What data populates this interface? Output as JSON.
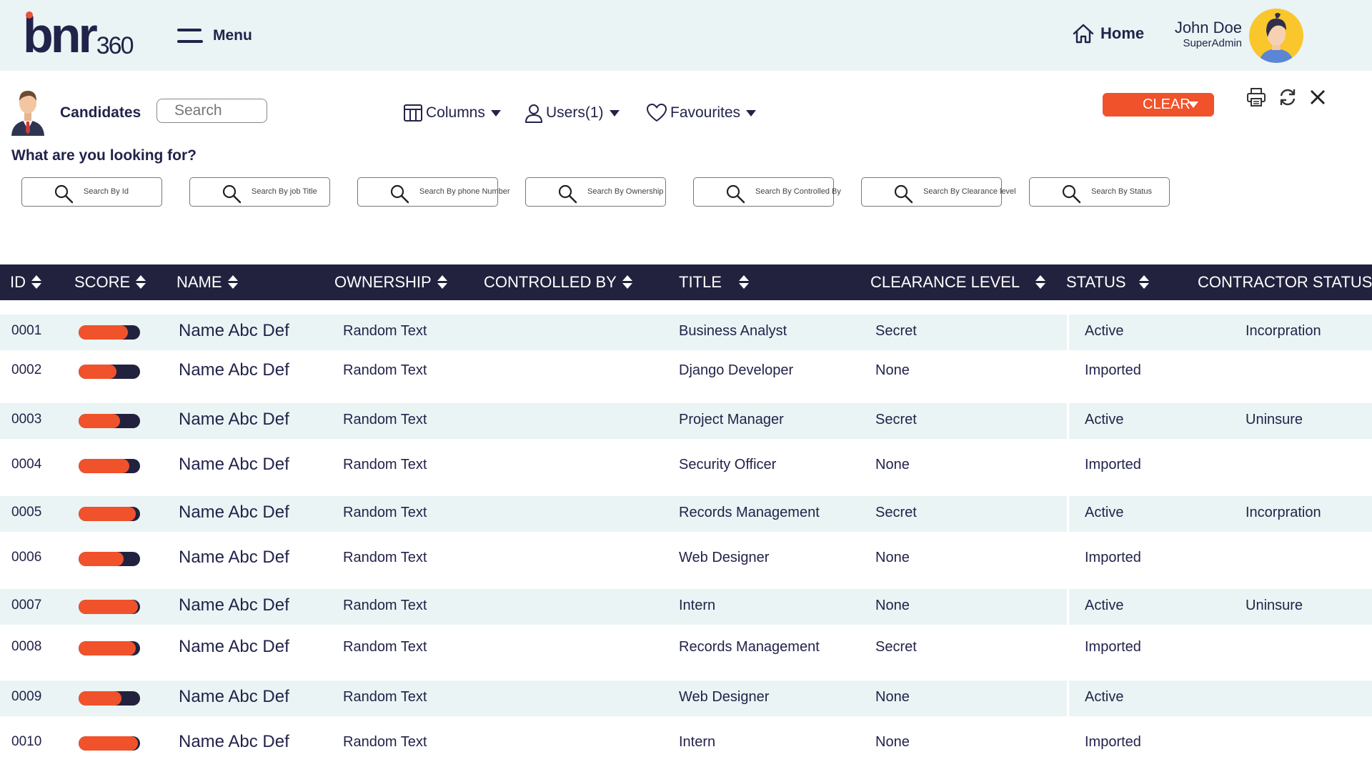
{
  "app": {
    "logo_text": "bnr",
    "logo_number": "360",
    "menu_label": "Menu",
    "home_label": "Home",
    "user": {
      "name": "John Doe",
      "role": "SuperAdmin"
    }
  },
  "toolbar": {
    "title": "Candidates",
    "search_placeholder": "Search",
    "columns_label": "Columns",
    "users_label": "Users(1)",
    "favourites_label": "Favourites",
    "clear_label": "CLEAR",
    "accent_color": "#f0522b"
  },
  "filters": {
    "heading": "What are you looking for?",
    "items": [
      {
        "placeholder": "Search By Id"
      },
      {
        "placeholder": "Search By job Title"
      },
      {
        "placeholder": "Search By  phone Number"
      },
      {
        "placeholder": "Search By Ownership"
      },
      {
        "placeholder": "Search By Controlled By"
      },
      {
        "placeholder": "Search By Clearance level"
      },
      {
        "placeholder": "Search By Status"
      }
    ]
  },
  "table": {
    "columns": [
      "ID",
      "SCORE",
      "NAME",
      "OWNERSHIP",
      "CONTROLLED BY",
      "TITLE",
      "CLEARANCE LEVEL",
      "STATUS",
      "CONTRACTOR STATUS"
    ],
    "rows": [
      {
        "id": "0001",
        "score": 0.8,
        "name": "Name Abc Def",
        "ownership": "Random Text",
        "controlled_by": "",
        "title": "Business Analyst",
        "clearance": "Secret",
        "status": "Active",
        "contractor": "Incorpration"
      },
      {
        "id": "0002",
        "score": 0.62,
        "name": "Name Abc Def",
        "ownership": "Random Text",
        "controlled_by": "",
        "title": "Django Developer",
        "clearance": "None",
        "status": "Imported",
        "contractor": ""
      },
      {
        "id": "0003",
        "score": 0.68,
        "name": "Name Abc Def",
        "ownership": "Random Text",
        "controlled_by": "",
        "title": "Project Manager",
        "clearance": "Secret",
        "status": "Active",
        "contractor": "Uninsure"
      },
      {
        "id": "0004",
        "score": 0.82,
        "name": "Name Abc Def",
        "ownership": "Random Text",
        "controlled_by": "",
        "title": "Security Officer",
        "clearance": "None",
        "status": "Imported",
        "contractor": ""
      },
      {
        "id": "0005",
        "score": 0.93,
        "name": "Name Abc Def",
        "ownership": "Random Text",
        "controlled_by": "",
        "title": "Records Management",
        "clearance": "Secret",
        "status": "Active",
        "contractor": "Incorpration"
      },
      {
        "id": "0006",
        "score": 0.73,
        "name": "Name Abc Def",
        "ownership": "Random Text",
        "controlled_by": "",
        "title": "Web Designer",
        "clearance": "None",
        "status": "Imported",
        "contractor": ""
      },
      {
        "id": "0007",
        "score": 0.97,
        "name": "Name Abc Def",
        "ownership": "Random Text",
        "controlled_by": "",
        "title": "Intern",
        "clearance": "None",
        "status": "Active",
        "contractor": "Uninsure"
      },
      {
        "id": "0008",
        "score": 0.93,
        "name": "Name Abc Def",
        "ownership": "Random Text",
        "controlled_by": "",
        "title": "Records Management",
        "clearance": "Secret",
        "status": "Imported",
        "contractor": ""
      },
      {
        "id": "0009",
        "score": 0.7,
        "name": "Name Abc Def",
        "ownership": "Random Text",
        "controlled_by": "",
        "title": "Web Designer",
        "clearance": "None",
        "status": "Active",
        "contractor": ""
      },
      {
        "id": "0010",
        "score": 0.97,
        "name": "Name Abc Def",
        "ownership": "Random Text",
        "controlled_by": "",
        "title": "Intern",
        "clearance": "None",
        "status": "Imported",
        "contractor": ""
      }
    ]
  },
  "icons": {
    "home": "home-icon",
    "columns": "columns-icon",
    "users": "user-icon",
    "favourites": "heart-icon",
    "print": "print-icon",
    "refresh": "refresh-icon",
    "close": "close-icon",
    "search": "search-icon"
  }
}
